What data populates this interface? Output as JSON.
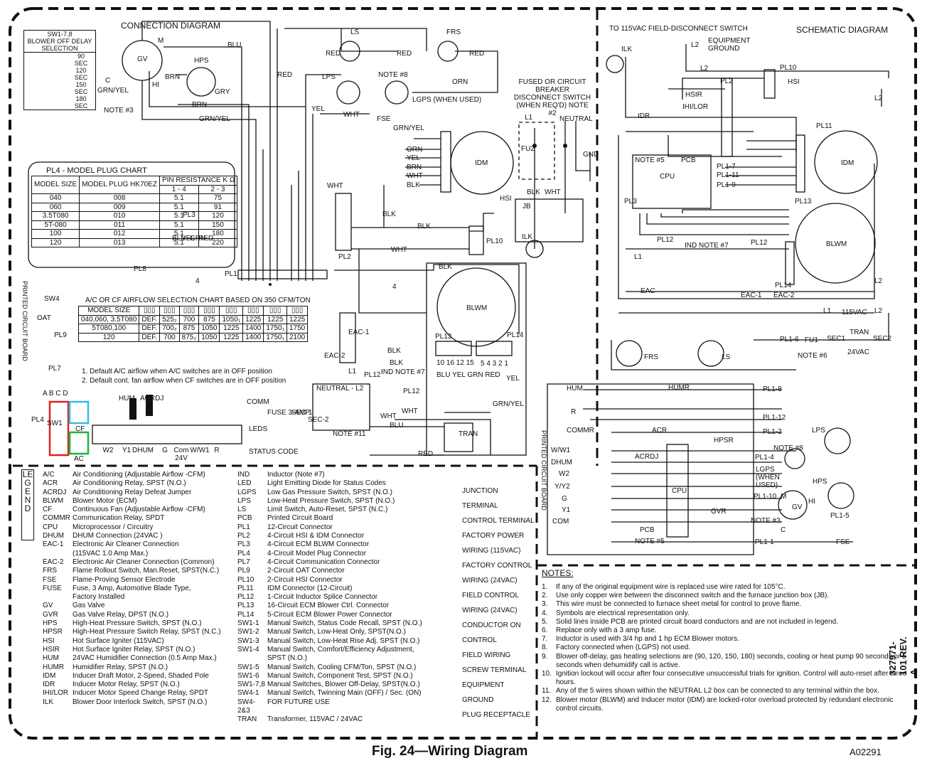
{
  "connection": {
    "title": "CONNECTION DIAGRAM",
    "sw_chart": {
      "title": [
        "SW1-7,8",
        "BLOWER OFF DELAY",
        "SELECTION"
      ],
      "rows": [
        [
          "90",
          "SEC"
        ],
        [
          "120",
          "SEC"
        ],
        [
          "150",
          "SEC"
        ],
        [
          "180",
          "SEC"
        ]
      ]
    },
    "pl4_chart": {
      "title": "PL4 - MODEL PLUG CHART",
      "headers": [
        "MODEL SIZE",
        "MODEL PLUG HK70EZ",
        "PIN RESISTANCE K Ω",
        "1 - 4",
        "2 - 3"
      ],
      "rows": [
        [
          "040",
          "008",
          "5.1",
          "75"
        ],
        [
          "060",
          "009",
          "5.1",
          "91"
        ],
        [
          "3.5T080",
          "010",
          "5.1",
          "120"
        ],
        [
          "5T-080",
          "011",
          "5.1",
          "150"
        ],
        [
          "100",
          "012",
          "5.1",
          "180"
        ],
        [
          "120",
          "013",
          "5.1",
          "220"
        ]
      ]
    },
    "airflow_chart": {
      "title": "A/C OR CF AIRFLOW SELECTION CHART BASED ON 350 CFM/TON",
      "header": "MODEL SIZE",
      "rows": [
        [
          "040,060, 3.5T080",
          "DEF.",
          "525₂",
          "700",
          "875",
          "1050₁",
          "1225",
          "1225",
          "1225"
        ],
        [
          "5T080,100",
          "DEF.",
          "700₂",
          "875",
          "1050",
          "1225",
          "1400",
          "1750₁",
          "1750"
        ],
        [
          "120",
          "DEF.",
          "700",
          "875₂",
          "1050",
          "1225",
          "1400",
          "1750₁",
          "2100"
        ]
      ],
      "footnotes": [
        "1. Default A/C airflow when A/C switches are in OFF position",
        "2. Default cont. fan airflow when CF switches are in OFF position"
      ]
    },
    "labels": [
      "M",
      "GV",
      "HI",
      "C",
      "GRN/YEL",
      "NOTE #3",
      "HPS",
      "BRN",
      "GRY",
      "BRN",
      "GRN/YEL",
      "BLU",
      "RED",
      "LS",
      "RED",
      "RED",
      "FRS",
      "RED",
      "LPS",
      "NOTE #8",
      "ORN",
      "LGPS (WHEN USED)",
      "YEL",
      "WHT",
      "FSE",
      "GRN/YEL",
      "ORN",
      "YEL",
      "BRN",
      "WHT",
      "BLK",
      "IDM",
      "WHT",
      "BLK",
      "HSI",
      "BLK",
      "WHT",
      "PL2",
      "PL10",
      "PL1",
      "PL3",
      "BLU",
      "YEL",
      "GRN",
      "RED",
      "PL8",
      "4",
      "SW4",
      "OAT",
      "PL9",
      "PL7",
      "A B C D",
      "PL4",
      "SW1",
      "CF",
      "AC",
      "HUM",
      "ACRDJ",
      "COMM",
      "LEDS",
      "STATUS CODE",
      "FUSE 3-AMP",
      "SEC-1",
      "SEC-2",
      "EAC-2",
      "EAC-1",
      "L1",
      "BLK",
      "BLK",
      "IND NOTE #7",
      "PL12",
      "PL13",
      "BLWM",
      "PL14",
      "BLK",
      "4",
      "NEUTRAL - L2",
      "NOTE #11",
      "WHT",
      "BLU",
      "RED",
      "WHT",
      "GRN/YEL",
      "YEL",
      "TRAN",
      "FUSED OR CIRCUIT BREAKER DISCONNECT SWITCH (WHEN REQ'D) NOTE #2",
      "L1",
      "NEUTRAL",
      "FU2",
      "GND",
      "BLK",
      "WHT",
      "JB",
      "ILK",
      "10 16 12 15",
      "BLU YEL GRN RED",
      "5 4 3 2 1",
      "PL12"
    ],
    "terminals": [
      "W2",
      "Y1",
      "DHUM",
      "G",
      "Com 24V",
      "W/W1",
      "R"
    ],
    "side_label": "PRINTED CIRCUIT BOARD"
  },
  "schematic": {
    "title": "SCHEMATIC DIAGRAM",
    "labels": [
      "TO 115VAC FIELD-DISCONNECT SWITCH",
      "L2",
      "EQUIPMENT GROUND",
      "ILK",
      "L2",
      "PL10",
      "HSI",
      "HSIR",
      "PL2",
      "IHI/LOR",
      "IDR",
      "L2",
      "PL11",
      "IDM",
      "NOTE #5",
      "PCB",
      "CPU",
      "PL1-7",
      "PL1-11",
      "PL1-9",
      "PL3",
      "PL13",
      "BLWM",
      "PL12",
      "IND NOTE #7",
      "PL12",
      "L1",
      "PL14",
      "L2",
      "EAC",
      "EAC-1",
      "EAC-2",
      "L1",
      "115VAC",
      "L2",
      "PL1-6",
      "FU1",
      "NOTE #6",
      "SEC1",
      "TRAN",
      "SEC2",
      "24VAC",
      "FRS",
      "LS",
      "HUM",
      "HUMR",
      "PL1-8",
      "R",
      "COMMR",
      "ACR",
      "HPSR",
      "PL1-12",
      "PL1-2",
      "LPS",
      "W/W1",
      "DHUM",
      "W2",
      "Y/Y2",
      "G",
      "Y1",
      "COM",
      "ACRDJ",
      "CPU",
      "NOTE #8",
      "PL1-4",
      "LGPS (WHEN USED)",
      "HPS",
      "PL1-10",
      "M",
      "GV",
      "HI",
      "GVR",
      "NOTE #3",
      "C",
      "PL1-5",
      "PCB",
      "NOTE #5",
      "PL1-1",
      "FSE"
    ],
    "side_label": "PRINTED CIRCUIT BOARD"
  },
  "legend": {
    "title": "LEGEND",
    "left": [
      [
        "A/C",
        "Air Conditioning (Adjustable Airflow -CFM)"
      ],
      [
        "ACR",
        "Air Conditioning Relay, SPST (N.O.)"
      ],
      [
        "ACRDJ",
        "Air Conditioning Relay Defeat Jumper"
      ],
      [
        "BLWM",
        "Blower Motor (ECM)"
      ],
      [
        "CF",
        "Continuous Fan (Adjustable Airflow -CFM)"
      ],
      [
        "COMMR",
        "Communication Relay, SPDT"
      ],
      [
        "CPU",
        "Microprocessor / Circuitry"
      ],
      [
        "DHUM",
        "DHUM Connection (24VAC )"
      ],
      [
        "EAC-1",
        "Electronic Air Cleaner Connection"
      ],
      [
        "",
        "(115VAC 1.0 Amp Max.)"
      ],
      [
        "EAC-2",
        "Electronic Air Cleaner Connection (Common)"
      ],
      [
        "FRS",
        "Flame Rollout Switch, Man.Reset, SPST(N.C.)"
      ],
      [
        "FSE",
        "Flame-Proving Sensor Electrode"
      ],
      [
        "FUSE",
        "Fuse, 3 Amp, Automotive Blade Type,"
      ],
      [
        "",
        "Factory Installed"
      ],
      [
        "GV",
        "Gas Valve"
      ],
      [
        "GVR",
        "Gas Valve Relay, DPST (N.O.)"
      ],
      [
        "HPS",
        "High-Heat Pressure Switch, SPST (N.O.)"
      ],
      [
        "HPSR",
        "High-Heat Pressure Switch Relay, SPST (N.C.)"
      ],
      [
        "HSI",
        "Hot Surface Igniter (115VAC)"
      ],
      [
        "HSIR",
        "Hot Surface Igniter Relay, SPST (N.O.)"
      ],
      [
        "HUM",
        "24VAC Humidifier Connection (0.5 Amp Max.)"
      ],
      [
        "HUMR",
        "Humidifier Relay, SPST (N.O.)"
      ],
      [
        "IDM",
        "Inducer Draft Motor, 2-Speed, Shaded Pole"
      ],
      [
        "IDR",
        "Inducer Motor Relay, SPST (N.O.)"
      ],
      [
        "IHI/LOR",
        "Inducer Motor Speed Change Relay, SPDT"
      ],
      [
        "ILK",
        "Blower Door Interlock Switch, SPST (N.O.)"
      ]
    ],
    "right": [
      [
        "IND",
        "Inductor (Note #7)"
      ],
      [
        "LED",
        "Light Emitting Diode for Status Codes"
      ],
      [
        "LGPS",
        "Low Gas Pressure Switch, SPST (N.O.)"
      ],
      [
        "LPS",
        "Low-Heat Pressure Switch, SPST (N.O.)"
      ],
      [
        "LS",
        "Limit Switch, Auto-Reset, SPST (N.C.)"
      ],
      [
        "PCB",
        "Printed Circuit Board"
      ],
      [
        "PL1",
        "12-Circuit Connector"
      ],
      [
        "PL2",
        "4-Circuit HSI & IDM Connector"
      ],
      [
        "PL3",
        "4-Circuit ECM BLWM Connector"
      ],
      [
        "PL4",
        "4-Circuit Model Plug Connector"
      ],
      [
        "PL7",
        "4-Circuit Communication Connector"
      ],
      [
        "PL9",
        "2-Circuit OAT Connector"
      ],
      [
        "PL10",
        "2-Circuit HSI Connector"
      ],
      [
        "PL11",
        "IDM Connector (12-Circuit)"
      ],
      [
        "PL12",
        "1-Circuit Inductor Splice Connector"
      ],
      [
        "PL13",
        "16-Circuit ECM Blower Ctrl. Connector"
      ],
      [
        "PL14",
        "5-Circuit ECM Blower Power Connector"
      ],
      [
        "SW1-1",
        "Manual Switch, Status Code Recall, SPST (N.O.)"
      ],
      [
        "SW1-2",
        "Manual Switch, Low-Heat Only,  SPST(N.O.)"
      ],
      [
        "SW1-3",
        "Manual Switch, Low-Heat Rise Adj. SPST (N.O.)"
      ],
      [
        "SW1-4",
        "Manual Switch, Comfort/Efficiency Adjustment,"
      ],
      [
        "",
        "SPST (N.O.)"
      ],
      [
        "SW1-5",
        "Manual Switch, Cooling CFM/Ton, SPST (N.O.)"
      ],
      [
        "SW1-6",
        "Manual Switch, Component Test, SPST (N.O.)"
      ],
      [
        "SW1-7,8",
        "Manual Switches, Blower Off-Delay, SPST(N.O.)"
      ],
      [
        "SW4-1",
        "Manual Switch, Twinning Main (OFF) / Sec. (ON)"
      ],
      [
        "SW4-2&3",
        "FOR FUTURE USE"
      ],
      [
        "TRAN",
        "Transformer, 115VAC / 24VAC"
      ]
    ],
    "symbols": [
      "JUNCTION",
      "TERMINAL",
      "CONTROL TERMINAL",
      "FACTORY POWER",
      "WIRING (115VAC)",
      "FACTORY CONTROL",
      "WIRING (24VAC)",
      "FIELD CONTROL",
      "WIRING (24VAC)",
      "CONDUCTOR ON",
      "CONTROL",
      "FIELD WIRING",
      "SCREW TERMINAL",
      "EQUIPMENT",
      "GROUND",
      "PLUG RECEPTACLE"
    ]
  },
  "notes": {
    "title": "NOTES:",
    "items": [
      "If any of the original equipment wire is replaced use wire rated for 105°C.",
      "Use only copper wire between the disconnect switch and the furnace junction box (JB).",
      "This wire must be connected to furnace sheet metal for control to prove flame.",
      "Symbols are electrical representation only.",
      "Solid lines inside PCB are printed circuit board conductors and are not included in legend.",
      "Replace only with a 3 amp fuse.",
      "Inductor is used with 3/4 hp and 1 hp ECM Blower motors.",
      "Factory connected when (LGPS) not used.",
      "Blower off-delay, gas heating selections are (90, 120, 150, 180) seconds, cooling or heat pump 90 seconds or 5 seconds when dehumidify call is active.",
      "Ignition lockout will occur after four consecutive unsuccessful trials for ignition.  Control will auto-reset after three hours.",
      "Any of the 5 wires shown within the NEUTRAL L2 box can be connected to any terminal within the box.",
      "Blower motor (BLWM) and Inducer motor (IDM) are locked-rotor overload protected by redundant electronic control circuits."
    ]
  },
  "footer": {
    "caption": "Fig. 24—Wiring Diagram",
    "code": "A02291",
    "revision": "327971-101 REV. A"
  },
  "colors": {
    "ink": "#111111",
    "sw1_highlight": "#e02020",
    "sw_cf_highlight": "#30c0e0",
    "sw_ac_highlight": "#20b040"
  }
}
